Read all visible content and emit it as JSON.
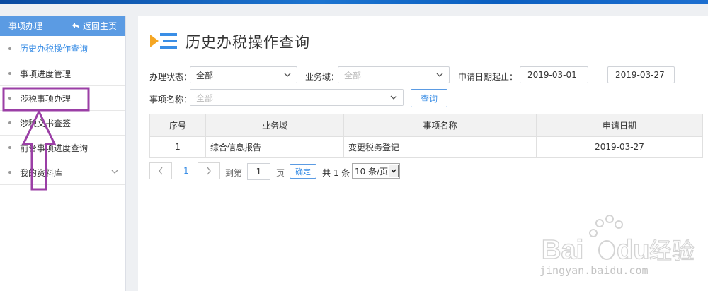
{
  "sidebar": {
    "title": "事项办理",
    "back_label": "返回主页",
    "items": [
      {
        "label": "历史办税操作查询",
        "active": true
      },
      {
        "label": "事项进度管理",
        "active": false
      },
      {
        "label": "涉税事项办理",
        "active": false
      },
      {
        "label": "涉税文书查签",
        "active": false
      },
      {
        "label": "前台事项进度查询",
        "active": false
      },
      {
        "label": "我的资料库",
        "active": false,
        "expandable": true
      }
    ]
  },
  "main": {
    "title": "历史办税操作查询",
    "filters": {
      "status_label": "办理状态：",
      "status_value": "全部",
      "domain_label": "业务域：",
      "domain_placeholder": "全部",
      "date_label": "申请日期起止：",
      "date_from": "2019-03-01",
      "date_separator": "-",
      "date_to": "2019-03-27",
      "item_label": "事项名称：",
      "item_placeholder": "全部",
      "query_button": "查询"
    },
    "table": {
      "headers": [
        "序号",
        "业务域",
        "事项名称",
        "申请日期"
      ],
      "rows": [
        {
          "index": "1",
          "domain": "综合信息报告",
          "item": "变更税务登记",
          "date": "2019-03-27"
        }
      ]
    },
    "pagination": {
      "current_page": "1",
      "goto_label": "到第",
      "goto_value": "1",
      "page_unit": "页",
      "confirm_label": "确定",
      "total_text": "共 1 条",
      "page_size": "10 条/页"
    }
  },
  "watermark": {
    "brand": "Baidu经验",
    "url": "jingyan.baidu.com"
  },
  "colors": {
    "accent": "#3a8ee6",
    "sidebar_header": "#5b9be3",
    "annotation": "#9b3fa6",
    "title_icon_orange": "#f5a623",
    "title_icon_blue": "#3a8ee6"
  }
}
